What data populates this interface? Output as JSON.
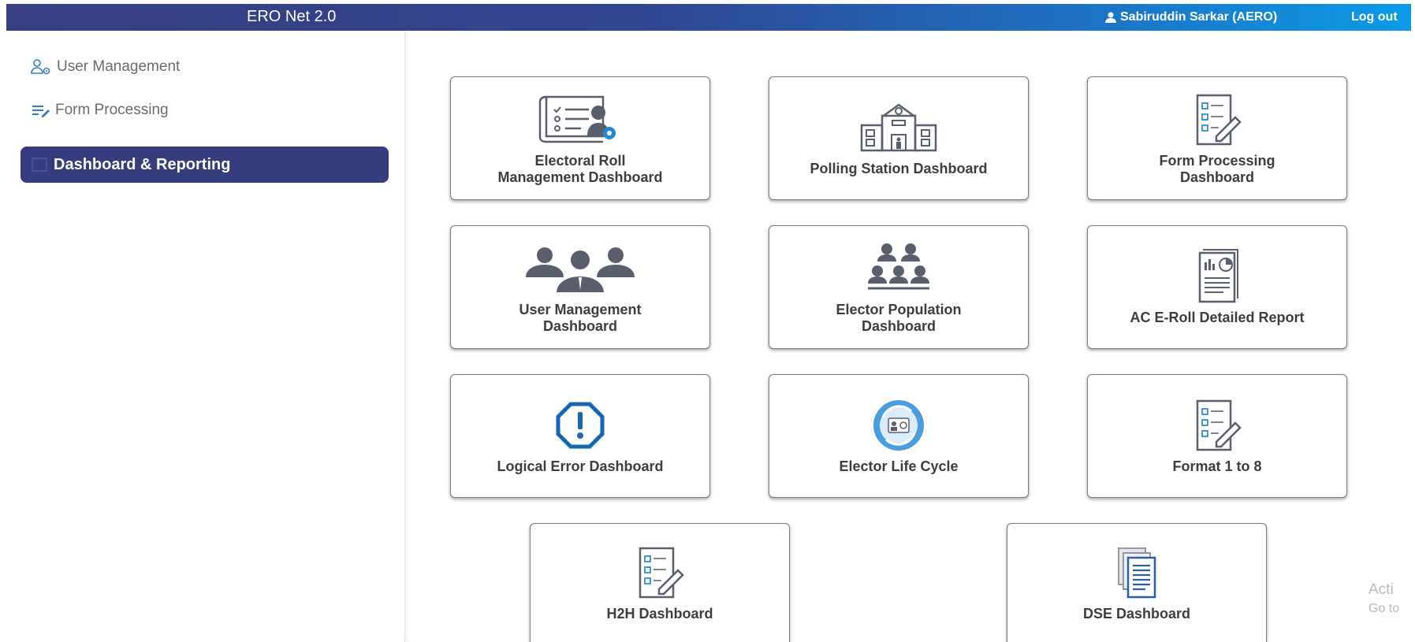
{
  "header": {
    "app_title": "ERO Net 2.0",
    "user_name": "Sabiruddin Sarkar (AERO)",
    "logout_label": "Log out"
  },
  "sidebar": {
    "items": [
      {
        "label": "User Management",
        "icon": "user-gear-icon"
      },
      {
        "label": "Form Processing",
        "icon": "list-edit-icon"
      },
      {
        "label": "Dashboard & Reporting",
        "icon": "dashboard-icon",
        "active": true
      }
    ]
  },
  "tiles": [
    {
      "label": "Electoral Roll Management Dashboard",
      "icon": "electoral-roll-icon"
    },
    {
      "label": "Polling Station Dashboard",
      "icon": "polling-station-icon"
    },
    {
      "label": "Form Processing Dashboard",
      "icon": "form-checklist-icon"
    },
    {
      "label": "User Management Dashboard",
      "icon": "users-group-icon"
    },
    {
      "label": "Elector Population Dashboard",
      "icon": "population-icon"
    },
    {
      "label": "AC E-Roll Detailed Report",
      "icon": "report-icon"
    },
    {
      "label": "Logical Error Dashboard",
      "icon": "error-octagon-icon"
    },
    {
      "label": "Elector Life Cycle",
      "icon": "life-cycle-icon"
    },
    {
      "label": "Format 1 to 8",
      "icon": "format-checklist-icon"
    },
    {
      "label": "H2H Dashboard",
      "icon": "h2h-checklist-icon"
    },
    {
      "label": "DSE Dashboard",
      "icon": "documents-icon"
    }
  ],
  "watermark": {
    "line1": "Acti",
    "line2": "Go to"
  },
  "colors": {
    "header_start": "#373f80",
    "header_end": "#0b9ae6",
    "active_item": "#363d7d",
    "icon_gray": "#5a5f6e",
    "icon_blue": "#1e78c8"
  }
}
